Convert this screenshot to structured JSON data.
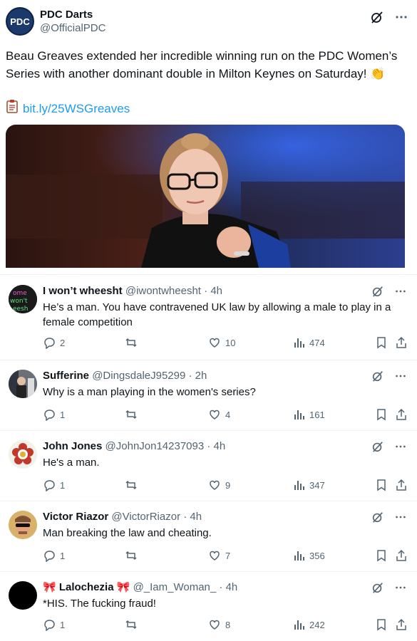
{
  "main": {
    "avatar_text": "PDC",
    "name": "PDC Darts",
    "handle": "@OfficialPDC",
    "text": "Beau Greaves extended her incredible winning run on the PDC Women’s Series with another dominant double in Milton Keynes on Saturday! 👏",
    "link": "bit.ly/25WSGreaves",
    "link_icon": "clipboard-icon",
    "more_icon": "more-icon",
    "grok_icon": "grok-icon",
    "photo_alt": "Darts player photo"
  },
  "replies": [
    {
      "name": "I won’t wheesht",
      "handle": "@iwontwheesht",
      "time": "· 4h",
      "text": "He’s a man. You have contravened UK law by allowing a male to play in a female competition",
      "comments": "2",
      "retweets": "",
      "likes": "10",
      "views": "474",
      "avatar_color": "#1a1a1a"
    },
    {
      "name": "Sufferine",
      "handle": "@DingsdaleJ95299",
      "time": "· 2h",
      "text": "Why is a man playing in the women's series?",
      "comments": "1",
      "retweets": "",
      "likes": "4",
      "views": "161",
      "avatar_color": "#5b5f68"
    },
    {
      "name": "John Jones",
      "handle": "@JohnJon14237093",
      "time": "· 4h",
      "text": "He's a man.",
      "comments": "1",
      "retweets": "",
      "likes": "9",
      "views": "347",
      "avatar_color": "#f4f1e8"
    },
    {
      "name": "Victor Riazor",
      "handle": "@VictorRiazor",
      "time": "· 4h",
      "text": "Man breaking the law and cheating.",
      "comments": "1",
      "retweets": "",
      "likes": "7",
      "views": "356",
      "avatar_color": "#d9b26a"
    },
    {
      "name": "🎀 Lalochezia 🎀",
      "handle": "@_Iam_Woman_",
      "time": "· 4h",
      "text": "*HIS.  The fucking fraud!",
      "comments": "1",
      "retweets": "",
      "likes": "8",
      "views": "242",
      "avatar_color": "#000000"
    }
  ]
}
